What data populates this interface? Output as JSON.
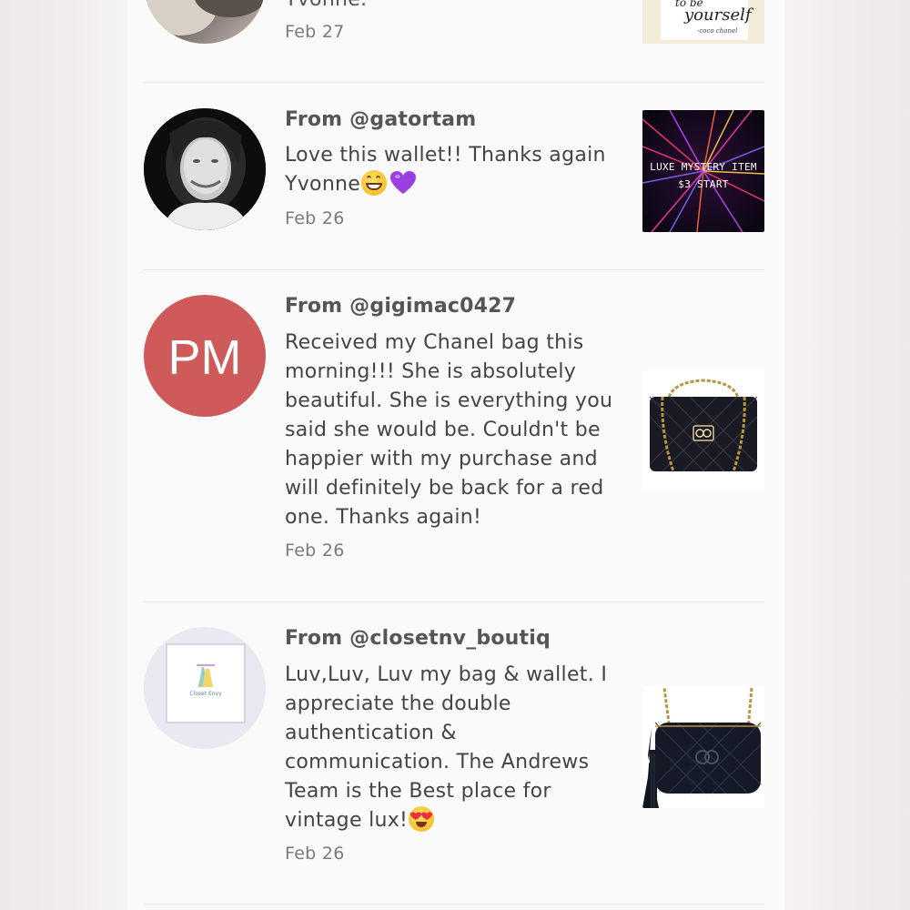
{
  "colors": {
    "panel_bg": "#fbfafa",
    "text_primary": "#444444",
    "text_secondary": "#7a7a7a",
    "avatar_initials_bg": "#cf5a5a"
  },
  "reviews": [
    {
      "username": "",
      "message": "Yvonne.",
      "date": "Feb 27",
      "avatar_icon": "user-photo-avatar",
      "thumbnail": {
        "type": "quote-card",
        "text_line1": "to be",
        "text_line2": "yourself",
        "text_line3": "-coco chanel"
      }
    },
    {
      "from_label": "From @gatortam",
      "message": "Love this wallet!! Thanks again Yvonne",
      "message_emojis": [
        "grinning-face-emoji",
        "purple-heart-emoji"
      ],
      "date": "Feb 26",
      "avatar_icon": "user-photo-avatar",
      "thumbnail": {
        "type": "listing-image",
        "text_line1": "LUXE MYSTERY ITEM",
        "text_line2": "$3 START"
      }
    },
    {
      "from_label": "From @gigimac0427",
      "message": "Received my Chanel bag this morning!!! She is absolutely beautiful. She is everything you said she would be. Couldn't be happier with my purchase and will definitely be back for a red one. Thanks again!",
      "date": "Feb 26",
      "avatar_initials": "PM",
      "thumbnail": {
        "type": "listing-image",
        "icon": "quilted-flap-bag-icon"
      }
    },
    {
      "from_label": "From @closetnv_boutiq",
      "message": "Luv,Luv, Luv my bag & wallet. I appreciate the double authentication & communication. The Andrews Team is the Best place for vintage lux!",
      "message_emojis": [
        "heart-eyes-emoji"
      ],
      "date": "Feb 26",
      "avatar_logo_text": "Closet Envy",
      "thumbnail": {
        "type": "listing-image",
        "icon": "quilted-camera-bag-icon"
      }
    }
  ]
}
